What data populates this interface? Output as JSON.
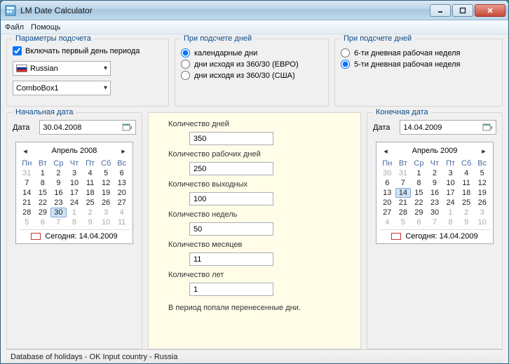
{
  "window": {
    "title": "LM Date Calculator"
  },
  "menu": {
    "file": "Файл",
    "help": "Помощь"
  },
  "params": {
    "title": "Параметры подсчета",
    "include_first_day": "Включать первый день периода",
    "lang": "Russian",
    "combobox": "ComboBox1"
  },
  "daycount1": {
    "title": "При подсчете дней",
    "opt1": "календарные дни",
    "opt2": "дни исходя из 360/30 (ЕВРО)",
    "opt3": "дни исходя из 360/30 (США)"
  },
  "daycount2": {
    "title": "При подсчете дней",
    "opt1": "6-ти дневная рабочая неделя",
    "opt2": "5-ти дневная рабочая неделя"
  },
  "start": {
    "title": "Начальная дата",
    "date_label": "Дата",
    "date_value": "30.04.2008",
    "cal_title": "Апрель 2008",
    "today": "Сегодня: 14.04.2009"
  },
  "end": {
    "title": "Конечная дата",
    "date_label": "Дата",
    "date_value": "14.04.2009",
    "cal_title": "Апрель 2009",
    "today": "Сегодня: 14.04.2009"
  },
  "weekdays": [
    "Пн",
    "Вт",
    "Ср",
    "Чт",
    "Пт",
    "Сб",
    "Вс"
  ],
  "cal_start": {
    "leading_off": [
      31
    ],
    "days": [
      1,
      2,
      3,
      4,
      5,
      6,
      7,
      8,
      9,
      10,
      11,
      12,
      13,
      14,
      15,
      16,
      17,
      18,
      19,
      20,
      21,
      22,
      23,
      24,
      25,
      26,
      27,
      28,
      29,
      30
    ],
    "selected": 30,
    "trailing_off": [
      1,
      2,
      3,
      4,
      5,
      6,
      7,
      8,
      9,
      10,
      11
    ]
  },
  "cal_end": {
    "leading_off": [
      30,
      31
    ],
    "days": [
      1,
      2,
      3,
      4,
      5,
      6,
      7,
      8,
      9,
      10,
      11,
      12,
      13,
      14,
      15,
      16,
      17,
      18,
      19,
      20,
      21,
      22,
      23,
      24,
      25,
      26,
      27,
      28,
      29,
      30
    ],
    "selected": 14,
    "trailing_off": [
      1,
      2,
      3,
      4,
      5,
      6,
      7,
      8,
      9,
      10
    ]
  },
  "center": {
    "l_days": "Количество дней",
    "v_days": "350",
    "l_workdays": "Количество рабочих дней",
    "v_workdays": "250",
    "l_weekend": "Количество выходных",
    "v_weekend": "100",
    "l_weeks": "Количество недель",
    "v_weeks": "50",
    "l_months": "Количество месяцев",
    "v_months": "11",
    "l_years": "Количество лет",
    "v_years": "1",
    "note": "В период попали перенесенные дни."
  },
  "status": "Database of holidays - OK Input country - Russia"
}
